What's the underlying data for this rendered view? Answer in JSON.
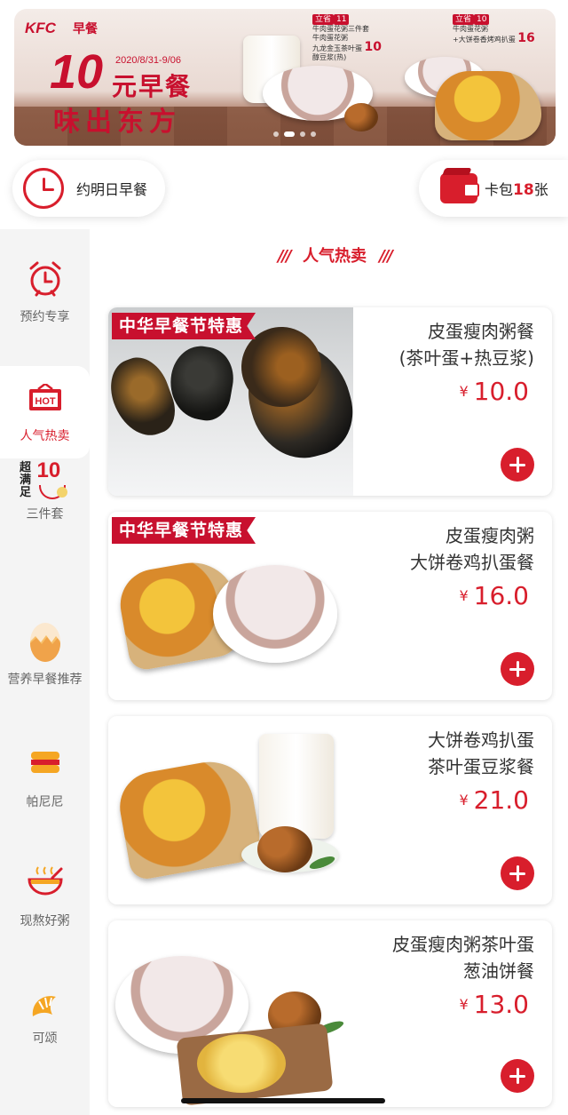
{
  "banner": {
    "brand": "KFC",
    "brand_sub": "早餐",
    "date_range": "2020/8/31-9/06",
    "big_number": "10",
    "headline_1": "元早餐",
    "headline_2": "味出东方",
    "offer_a": {
      "badge": "立省",
      "saving": "11",
      "line1": "牛肉蛋花粥三件套",
      "line2": "牛肉蛋花粥",
      "line3": "九龙金玉茶叶蛋",
      "line4": "醇豆浆(热)",
      "price": "10"
    },
    "offer_b": {
      "badge": "立省",
      "saving": "10",
      "line1": "牛肉蛋花粥",
      "line2": "+大饼卷香烤鸡扒蛋",
      "price": "16"
    },
    "slide_count": 4,
    "active_slide": 1
  },
  "actions": {
    "reserve_label": "约明日早餐",
    "wallet_label": "卡包",
    "wallet_count": "18",
    "wallet_unit": "张"
  },
  "sidebar": {
    "items": [
      {
        "label": "预约专享",
        "icon": "alarm-clock-icon",
        "active": false
      },
      {
        "label": "人气热卖",
        "icon": "hot-sign-icon",
        "active": true
      },
      {
        "label": "三件套",
        "icon": "combo-10-icon",
        "icon_text_a": "超满足",
        "icon_text_b": "10",
        "active": false
      },
      {
        "label": "营养早餐推荐",
        "icon": "egg-icon",
        "active": false
      },
      {
        "label": "帕尼尼",
        "icon": "sandwich-icon",
        "active": false
      },
      {
        "label": "现熬好粥",
        "icon": "porridge-bowl-icon",
        "active": false
      },
      {
        "label": "可颂",
        "icon": "croissant-icon",
        "active": false
      }
    ]
  },
  "section": {
    "title": "人气热卖",
    "deco": "///"
  },
  "products": [
    {
      "name_line1": "皮蛋瘦肉粥餐",
      "name_line2": "(茶叶蛋+热豆浆)",
      "currency": "¥",
      "price": "10.0",
      "promo": "中华早餐节特惠"
    },
    {
      "name_line1": "皮蛋瘦肉粥",
      "name_line2": "大饼卷鸡扒蛋餐",
      "currency": "¥",
      "price": "16.0",
      "promo": "中华早餐节特惠"
    },
    {
      "name_line1": "大饼卷鸡扒蛋",
      "name_line2": "茶叶蛋豆浆餐",
      "currency": "¥",
      "price": "21.0",
      "promo": ""
    },
    {
      "name_line1": "皮蛋瘦肉粥茶叶蛋",
      "name_line2": "葱油饼餐",
      "currency": "¥",
      "price": "13.0",
      "promo": ""
    }
  ],
  "colors": {
    "accent": "#d81e2c",
    "brand_red": "#c8102e",
    "sidebar_bg": "#f4f4f4"
  }
}
